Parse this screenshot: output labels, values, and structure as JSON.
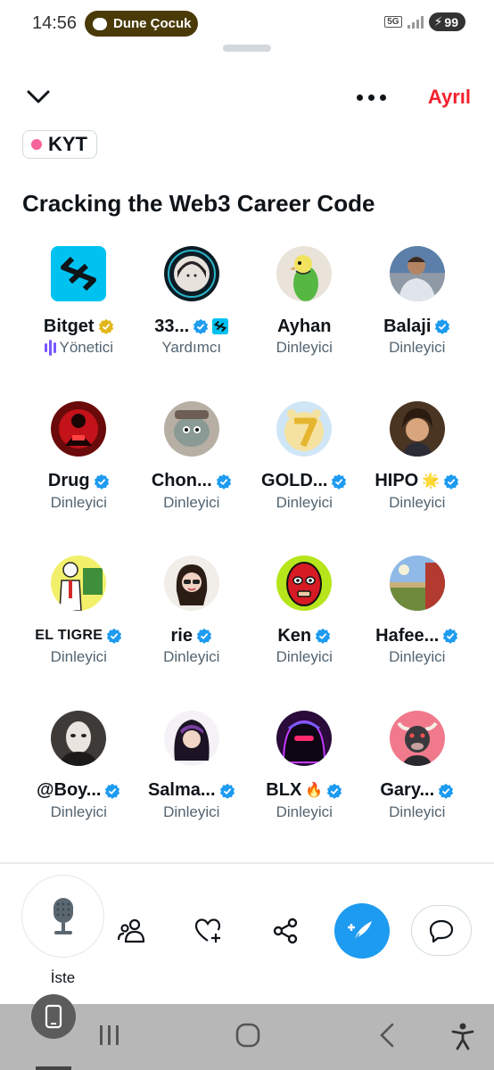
{
  "status_bar": {
    "time": "14:56",
    "notification": "Dune Çocuk",
    "network": "5G",
    "battery": "99"
  },
  "header": {
    "leave_label": "Ayrıl",
    "tag_label": "KYT"
  },
  "space": {
    "title": "Cracking the Web3 Career Code"
  },
  "participants": [
    {
      "name": "Bitget",
      "role": "Yönetici",
      "badge": "gold",
      "avatar": "bitget-logo"
    },
    {
      "name": "33...",
      "role": "Yardımcı",
      "badge": "blue",
      "extra": "bitget-mini-logo",
      "avatar": "avatar-33"
    },
    {
      "name": "Ayhan",
      "role": "Dinleyici",
      "badge": "none",
      "avatar": "parakeet"
    },
    {
      "name": "Balaji",
      "role": "Dinleyici",
      "badge": "blue",
      "avatar": "man-photo"
    },
    {
      "name": "Drug",
      "role": "Dinleyici",
      "badge": "blue",
      "avatar": "red-figure"
    },
    {
      "name": "Chon...",
      "role": "Dinleyici",
      "badge": "blue",
      "avatar": "cartoon-head"
    },
    {
      "name": "GOLD...",
      "role": "Dinleyici",
      "badge": "blue",
      "avatar": "gold-seven"
    },
    {
      "name": "HIPO",
      "role": "Dinleyici",
      "badge": "blue",
      "emoji": "🌟",
      "avatar": "anime-boy"
    },
    {
      "name": "EL TIGRE",
      "role": "Dinleyici",
      "badge": "blue",
      "avatar": "el-tigre"
    },
    {
      "name": "rie",
      "role": "Dinleyici",
      "badge": "blue",
      "avatar": "woman-glasses"
    },
    {
      "name": "Ken",
      "role": "Dinleyici",
      "badge": "blue",
      "avatar": "red-mask"
    },
    {
      "name": "Hafee...",
      "role": "Dinleyici",
      "badge": "blue",
      "avatar": "landscape"
    },
    {
      "name": "@Boy...",
      "role": "Dinleyici",
      "badge": "blue",
      "avatar": "white-mask"
    },
    {
      "name": "Salma...",
      "role": "Dinleyici",
      "badge": "blue",
      "avatar": "dark-hair-girl"
    },
    {
      "name": "BLX",
      "role": "Dinleyici",
      "badge": "blue",
      "emoji": "🔥",
      "avatar": "neon-hood"
    },
    {
      "name": "Gary...",
      "role": "Dinleyici",
      "badge": "blue",
      "avatar": "bull"
    }
  ],
  "bottom_bar": {
    "mic_label": "İste",
    "icons": [
      "microphone-icon",
      "people-icon",
      "heart-plus-icon",
      "share-icon",
      "compose-icon",
      "chat-icon"
    ]
  },
  "colors": {
    "accent": "#1d9bf0",
    "leave": "#f4212e",
    "verified_gold": "#e2b719",
    "speaking": "#7856ff"
  }
}
